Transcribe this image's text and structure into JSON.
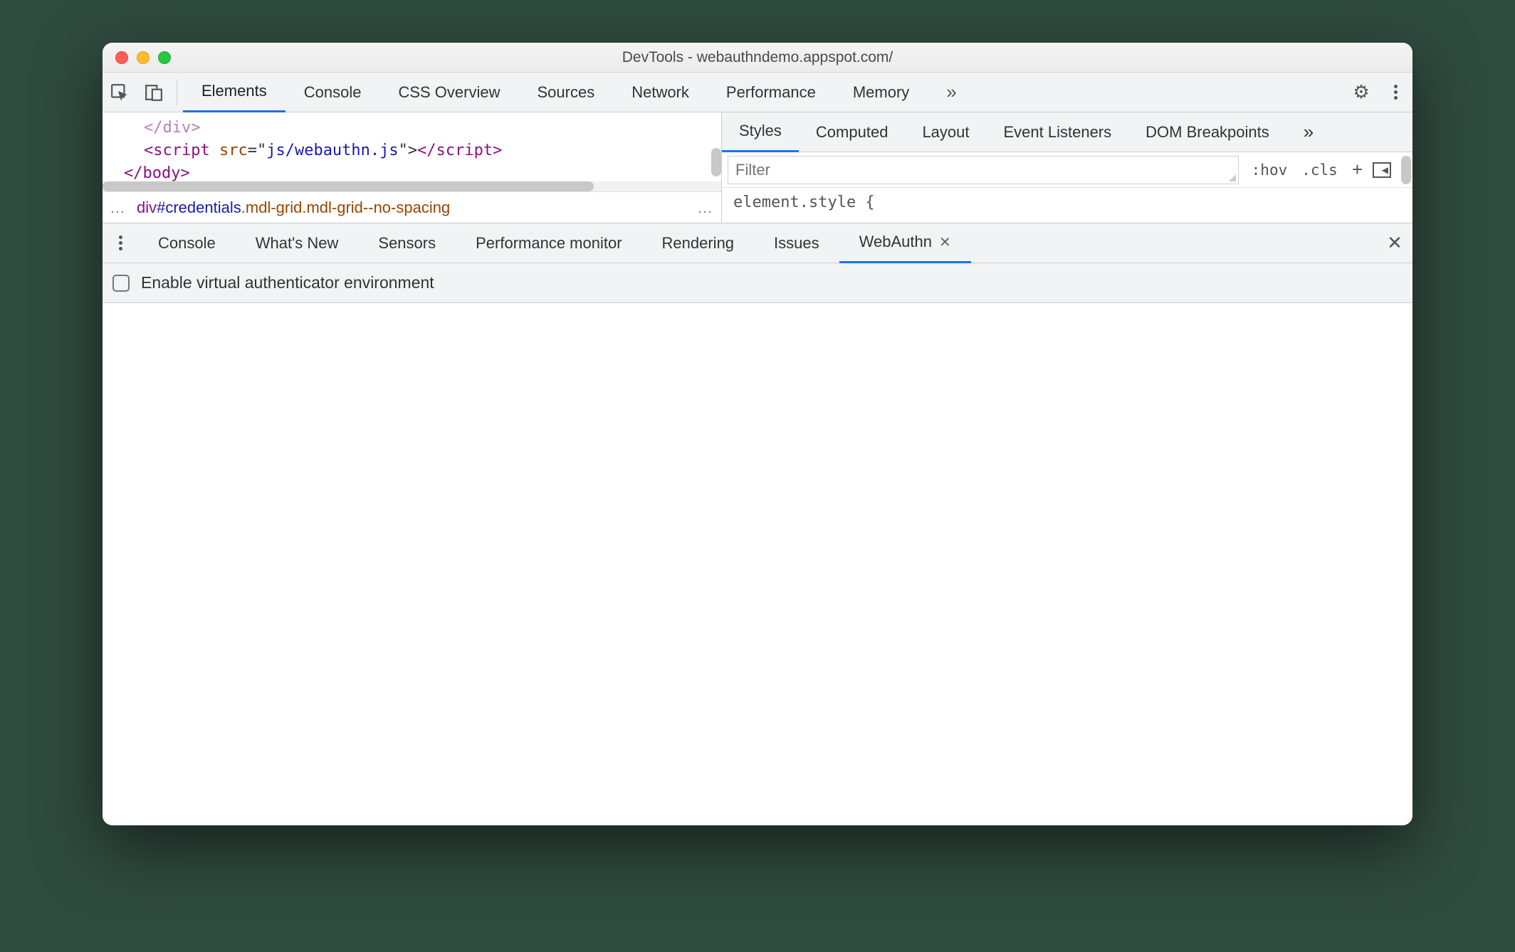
{
  "titlebar": {
    "title": "DevTools - webauthndemo.appspot.com/"
  },
  "main_tabs": {
    "items": [
      "Elements",
      "Console",
      "CSS Overview",
      "Sources",
      "Network",
      "Performance",
      "Memory"
    ],
    "active": "Elements",
    "overflow": "»"
  },
  "code": {
    "line1_close": "</div>",
    "line2_open": "<script ",
    "line2_attr": "src",
    "line2_eq": "=\"",
    "line2_val": "js/webauthn.js",
    "line2_endq": "\">",
    "line2_close": "</script>",
    "line3": "</body>"
  },
  "breadcrumb": {
    "ell": "…",
    "tag": "div",
    "id": "#credentials",
    "cls": ".mdl-grid.mdl-grid--no-spacing",
    "ell2": "…"
  },
  "styles_tabs": {
    "items": [
      "Styles",
      "Computed",
      "Layout",
      "Event Listeners",
      "DOM Breakpoints"
    ],
    "active": "Styles",
    "overflow": "»"
  },
  "filter": {
    "placeholder": "Filter",
    "hov": ":hov",
    "cls": ".cls",
    "plus": "+"
  },
  "styles_body": "element.style {",
  "drawer_tabs": {
    "items": [
      "Console",
      "What's New",
      "Sensors",
      "Performance monitor",
      "Rendering",
      "Issues",
      "WebAuthn"
    ],
    "active": "WebAuthn"
  },
  "drawer": {
    "checkbox_label": "Enable virtual authenticator environment"
  }
}
